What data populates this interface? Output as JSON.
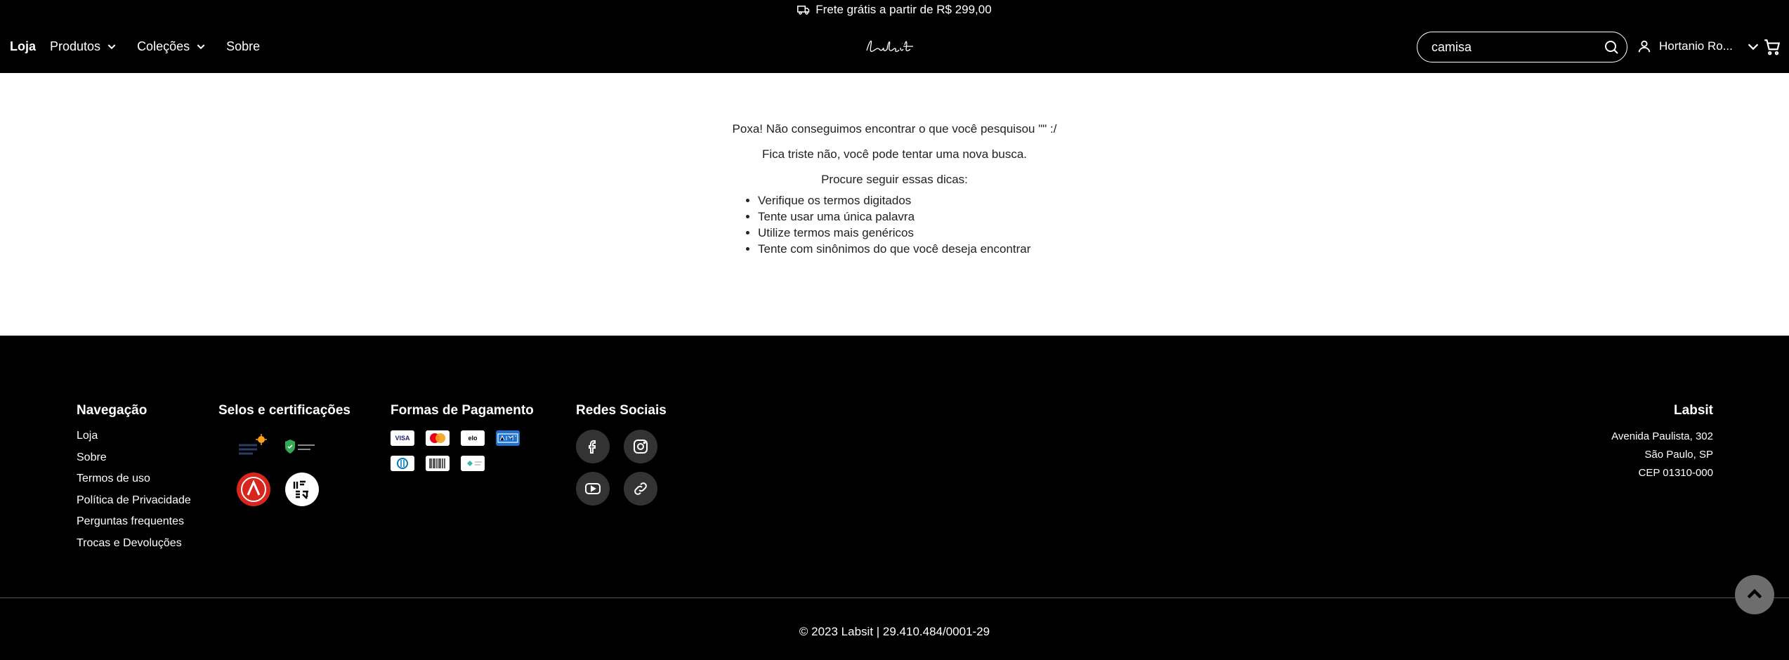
{
  "announcement": {
    "text": "Frete grátis a partir de R$ 299,00",
    "icon": "truck-icon"
  },
  "nav": {
    "items": [
      {
        "label": "Loja",
        "active": true,
        "dropdown": false
      },
      {
        "label": "Produtos",
        "active": false,
        "dropdown": true
      },
      {
        "label": "Coleções",
        "active": false,
        "dropdown": true
      },
      {
        "label": "Sobre",
        "active": false,
        "dropdown": false
      }
    ]
  },
  "search": {
    "value": "camisa",
    "icon": "search-icon"
  },
  "user": {
    "name": "Hortanio Ro...",
    "icon": "user-icon"
  },
  "cart": {
    "icon": "cart-icon"
  },
  "main": {
    "line1": "Poxa! Não conseguimos encontrar o que você pesquisou \"\" :/",
    "line2": "Fica triste não, você pode tentar uma nova busca.",
    "line3": "Procure seguir essas dicas:",
    "tips": [
      "Verifique os termos digitados",
      "Tente usar uma única palavra",
      "Utilize termos mais genéricos",
      "Tente com sinônimos do que você deseja encontrar"
    ]
  },
  "footer": {
    "nav_title": "Navegação",
    "nav_links": [
      "Loja",
      "Sobre",
      "Termos de uso",
      "Política de Privacidade",
      "Perguntas frequentes",
      "Trocas e Devoluções"
    ],
    "seals_title": "Selos e certificações",
    "payments_title": "Formas de Pagamento",
    "social_title": "Redes Sociais",
    "company_title": "Labsit",
    "address": [
      "Avenida Paulista, 302",
      "São Paulo, SP",
      "CEP 01310-000"
    ],
    "copyright": "© 2023 Labsit | 29.410.484/0001-29",
    "payment_labels": {
      "visa": "VISA",
      "elo": "elo"
    }
  },
  "colors": {
    "background_dark": "#000000",
    "text_light": "#ffffff",
    "amex_blue": "#1f72cd",
    "scroll_button": "#6d6d6d"
  }
}
